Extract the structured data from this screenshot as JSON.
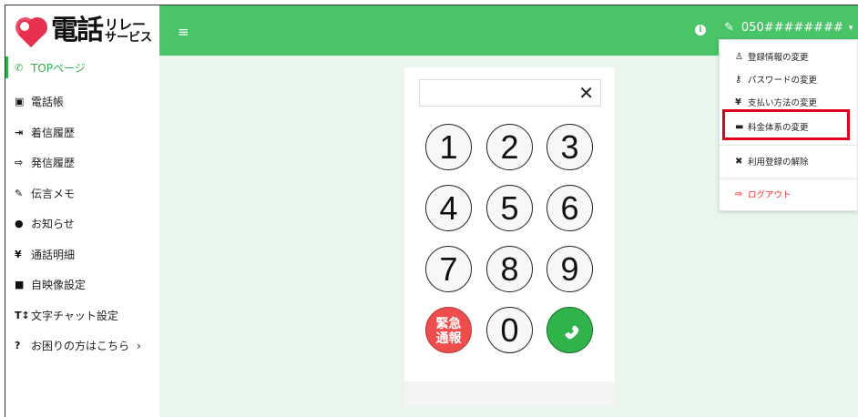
{
  "logo": {
    "main": "電話",
    "sub_top": "リレー",
    "sub_bottom": "サービス"
  },
  "sidebar": {
    "items": [
      {
        "label": "TOPページ",
        "icon": "phone-icon",
        "glyph": "✆"
      },
      {
        "label": "電話帳",
        "icon": "address-book-icon",
        "glyph": "▣"
      },
      {
        "label": "着信履歴",
        "icon": "incoming-icon",
        "glyph": "⇥"
      },
      {
        "label": "発信履歴",
        "icon": "outgoing-icon",
        "glyph": "⇨"
      },
      {
        "label": "伝言メモ",
        "icon": "edit-icon",
        "glyph": "✎"
      },
      {
        "label": "お知らせ",
        "icon": "info-icon",
        "glyph": "●"
      },
      {
        "label": "通話明細",
        "icon": "yen-icon",
        "glyph": "¥"
      },
      {
        "label": "自映像設定",
        "icon": "video-icon",
        "glyph": "■"
      },
      {
        "label": "文字チャット設定",
        "icon": "text-size-icon",
        "glyph": "T↕"
      },
      {
        "label": "お困りの方はこちら",
        "icon": "help-icon",
        "glyph": "?",
        "chevron": "›"
      }
    ]
  },
  "header": {
    "menu_glyph": "≡",
    "info_glyph": "i",
    "user_number": "050########",
    "caret": "▾",
    "edit_glyph": "✎"
  },
  "keypad": {
    "clear_glyph": "✕",
    "keys": [
      "1",
      "2",
      "3",
      "4",
      "5",
      "6",
      "7",
      "8",
      "9"
    ],
    "zero": "0",
    "emergency_line1": "緊急",
    "emergency_line2": "通報",
    "call_glyph": "✆"
  },
  "dropdown": {
    "items": [
      {
        "label": "登録情報の変更",
        "icon": "user-icon",
        "glyph": "♙"
      },
      {
        "label": "パスワードの変更",
        "icon": "key-icon",
        "glyph": "⚷"
      },
      {
        "label": "支払い方法の変更",
        "icon": "yen-icon",
        "glyph": "¥"
      },
      {
        "label": "料金体系の変更",
        "icon": "wallet-icon",
        "glyph": "▬"
      },
      {
        "label": "利用登録の解除",
        "icon": "user-remove-icon",
        "glyph": "✖"
      },
      {
        "label": "ログアウト",
        "icon": "logout-icon",
        "glyph": "⇨"
      }
    ]
  },
  "colors": {
    "accent": "#49c467",
    "highlight": "#e0001b",
    "emergency": "#ee4d4d",
    "call": "#2fb34a"
  }
}
